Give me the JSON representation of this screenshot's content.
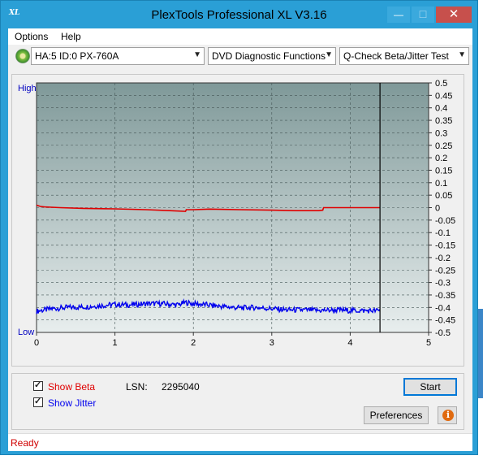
{
  "window": {
    "title": "PlexTools Professional XL V3.16",
    "icon_label": "XL",
    "minimize_glyph": "—",
    "maximize_glyph": "☐",
    "close_glyph": "✕"
  },
  "menu": {
    "items": [
      {
        "label": "Options"
      },
      {
        "label": "Help"
      }
    ]
  },
  "toolbar": {
    "drive": "HA:5 ID:0  PX-760A",
    "function": "DVD Diagnostic Functions",
    "test": "Q-Check Beta/Jitter Test",
    "arrow_glyph": "▼"
  },
  "chart_data": {
    "type": "line",
    "xlim": [
      0,
      5
    ],
    "ylim": [
      -0.5,
      0.5
    ],
    "x_ticks": [
      0,
      1,
      2,
      3,
      4,
      5
    ],
    "y_ticks": [
      0.5,
      0.45,
      0.4,
      0.35,
      0.3,
      0.25,
      0.2,
      0.15,
      0.1,
      0.05,
      0,
      -0.05,
      -0.1,
      -0.15,
      -0.2,
      -0.25,
      -0.3,
      -0.35,
      -0.4,
      -0.45,
      -0.5
    ],
    "left_labels": {
      "top": "High",
      "bottom": "Low"
    },
    "end_marker_x": 4.38,
    "grid": true,
    "series": [
      {
        "color": "#e00000",
        "x": [
          0,
          0.05,
          0.1,
          0.3,
          0.6,
          1.0,
          1.4,
          1.7,
          1.9,
          1.91,
          2.0,
          2.2,
          2.6,
          3.0,
          3.3,
          3.6,
          3.65,
          3.66,
          3.9,
          4.2,
          4.38
        ],
        "y": [
          0.01,
          0.005,
          0.003,
          0.0,
          -0.003,
          -0.005,
          -0.008,
          -0.012,
          -0.015,
          -0.008,
          -0.008,
          -0.006,
          -0.008,
          -0.01,
          -0.012,
          -0.012,
          -0.01,
          0.0,
          0.0,
          0.0,
          0.0
        ]
      },
      {
        "color": "#0000ee",
        "x": [
          0,
          0.2,
          0.4,
          0.6,
          0.8,
          1.0,
          1.2,
          1.4,
          1.6,
          1.8,
          1.9,
          2.0,
          2.2,
          2.4,
          2.6,
          2.8,
          3.0,
          3.2,
          3.4,
          3.6,
          3.8,
          4.0,
          4.2,
          4.38
        ],
        "y": [
          -0.415,
          -0.405,
          -0.4,
          -0.398,
          -0.393,
          -0.388,
          -0.39,
          -0.385,
          -0.385,
          -0.39,
          -0.38,
          -0.385,
          -0.39,
          -0.397,
          -0.402,
          -0.4,
          -0.405,
          -0.41,
          -0.41,
          -0.412,
          -0.41,
          -0.412,
          -0.413,
          -0.413
        ]
      }
    ]
  },
  "options": {
    "show_beta": "Show Beta",
    "show_jitter": "Show Jitter",
    "lsn_label": "LSN:",
    "lsn_value": "2295040",
    "beta_color": "#e00000",
    "jitter_color": "#0000ee"
  },
  "buttons": {
    "start": "Start",
    "preferences": "Preferences",
    "info_glyph": "i"
  },
  "status": {
    "text": "Ready"
  }
}
